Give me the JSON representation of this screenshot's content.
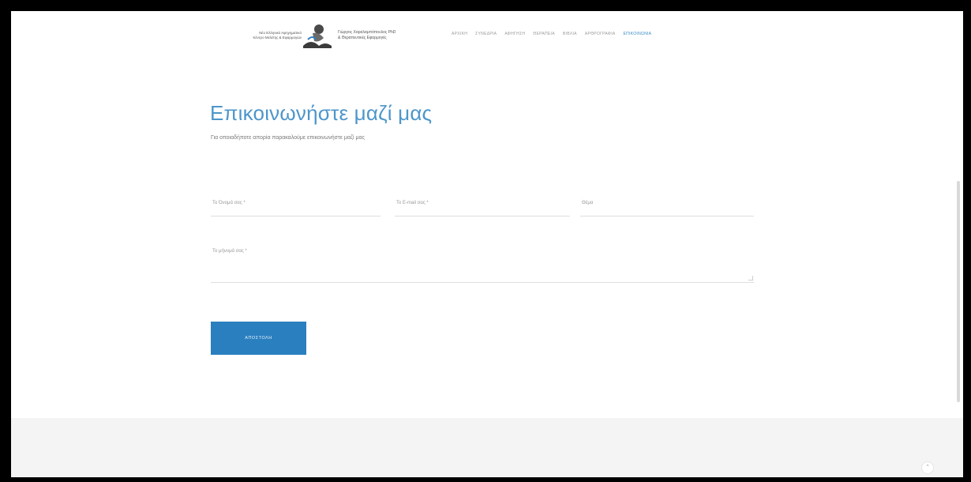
{
  "header": {
    "logo_left_line1": "Νέο Ελληνικό Αφηγηματικό",
    "logo_left_line2": "Κέντρο Μελέτης & Εφαρμογών",
    "logo_right_line1": "Γιώργος Χαραλαμπόπουλος PhD",
    "logo_right_line2": "& Θεραπευτικές Εφαρμογές",
    "nav": [
      {
        "label": "ΑΡΧΙΚΗ",
        "active": false
      },
      {
        "label": "ΣΥΝΕΔΡΙΑ",
        "active": false
      },
      {
        "label": "ΑΦΗΓΗΣΗ",
        "active": false
      },
      {
        "label": "ΘΕΡΑΠΕΙΑ",
        "active": false
      },
      {
        "label": "ΒΙΒΛΙΑ",
        "active": false
      },
      {
        "label": "ΑΡΘΡΟΓΡΑΦΙΑ",
        "active": false
      },
      {
        "label": "ΕΠΙΚΟΙΝΩΝΙΑ",
        "active": true
      }
    ]
  },
  "main": {
    "title": "Επικοινωνήστε μαζί μας",
    "subtitle": "Για οποιαδήποτε απορία παρακαλούμε επικοινωνήστε μαζί μας"
  },
  "form": {
    "name_label": "Το Όνομά σας *",
    "email_label": "Το E-mail σας *",
    "subject_label": "Θέμα",
    "message_label": "Το μήνυμά σας *",
    "submit_label": "ΑΠΟΣΤΟΛΗ"
  },
  "footer": {
    "scroll_top_glyph": "⌃"
  },
  "colors": {
    "accent": "#4d96cb",
    "button": "#2a7fbf",
    "footer_bg": "#f4f4f4"
  }
}
